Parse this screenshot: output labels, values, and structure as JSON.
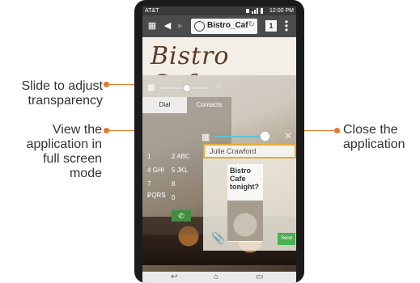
{
  "callouts": {
    "transparency_line1": "Slide to adjust",
    "transparency_line2": "transparency",
    "fullscreen_line1": "View the",
    "fullscreen_line2": "application in",
    "fullscreen_line3": "full screen",
    "fullscreen_line4": "mode",
    "close_line1": "Close the",
    "close_line2": "application",
    "accent_color": "#e8792b"
  },
  "statusbar": {
    "carrier": "AT&T",
    "time": "12:00 PM"
  },
  "browser": {
    "url": "Bistro_Caf",
    "tab_count": "1"
  },
  "site": {
    "title": "Bistro Cafe"
  },
  "dialer": {
    "tabs": [
      "Dial",
      "Contacts"
    ],
    "keys": [
      "1",
      "2 ABC",
      "4 GHI",
      "5 JKL",
      "7 PQRS",
      "8",
      "*",
      "0"
    ]
  },
  "message": {
    "recipient": "Julie Crawford",
    "text_line1": "Bistro",
    "text_line2": "Cafe",
    "text_line3": "tonight?",
    "send_label": "Send",
    "send_color": "#4caf50",
    "highlight_color": "#e2ad3b"
  },
  "navbar": {
    "icons": [
      "back-icon",
      "home-icon",
      "recent-apps-icon"
    ]
  }
}
